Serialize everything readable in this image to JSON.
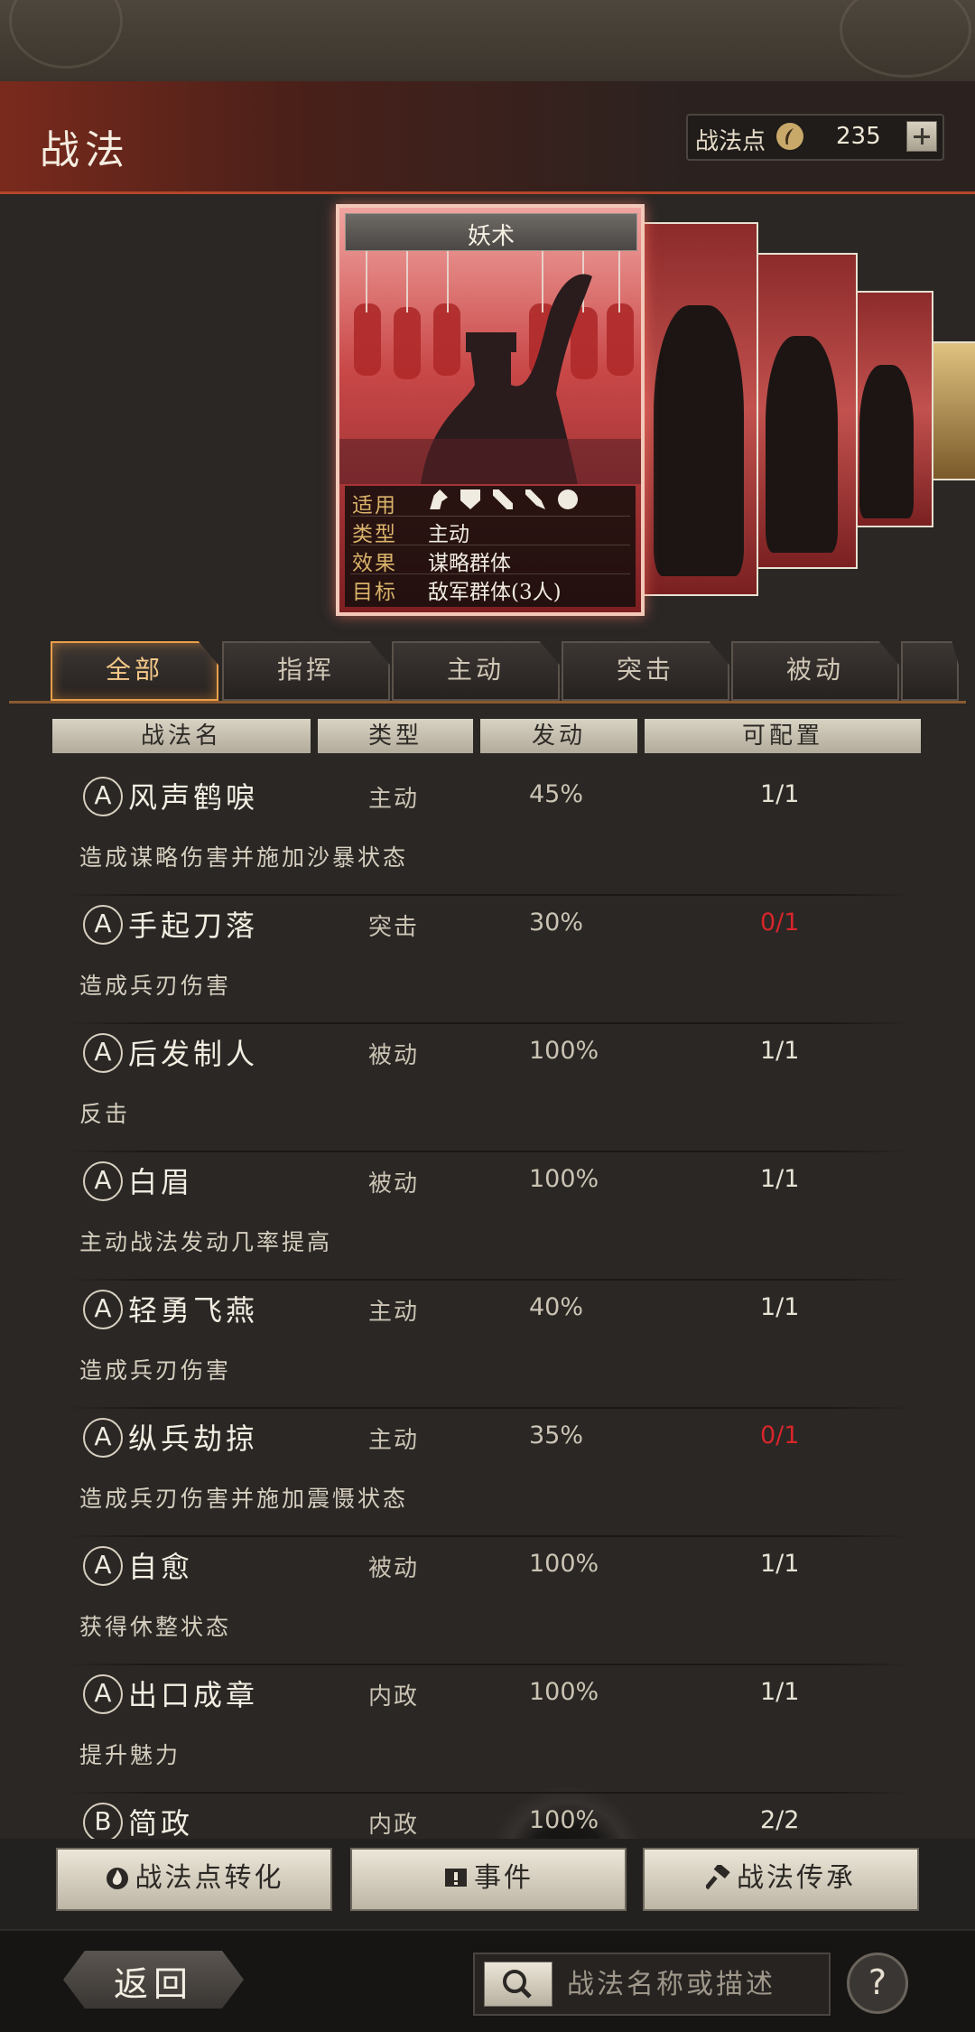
{
  "header": {
    "title": "战法",
    "points_label": "战法点",
    "points_value": "235"
  },
  "card": {
    "name": "妖术",
    "rows": [
      {
        "key": "适用",
        "value": ""
      },
      {
        "key": "类型",
        "value": "主动"
      },
      {
        "key": "效果",
        "value": "谋略群体"
      },
      {
        "key": "目标",
        "value": "敌军群体(3人)"
      }
    ],
    "applicable_icons": [
      "cavalry-icon",
      "shield-icon",
      "bow-icon",
      "spear-icon",
      "wheel-icon"
    ]
  },
  "tabs": [
    {
      "label": "全部",
      "active": true
    },
    {
      "label": "指挥",
      "active": false
    },
    {
      "label": "主动",
      "active": false
    },
    {
      "label": "突击",
      "active": false
    },
    {
      "label": "被动",
      "active": false
    }
  ],
  "table_headers": [
    "战法名",
    "类型",
    "发动",
    "可配置"
  ],
  "skills": [
    {
      "grade": "A",
      "name": "风声鹤唳",
      "type": "主动",
      "rate": "45%",
      "config": "1/1",
      "config_full": false,
      "desc": "造成谋略伤害并施加沙暴状态"
    },
    {
      "grade": "A",
      "name": "手起刀落",
      "type": "突击",
      "rate": "30%",
      "config": "0/1",
      "config_full": true,
      "desc": "造成兵刃伤害"
    },
    {
      "grade": "A",
      "name": "后发制人",
      "type": "被动",
      "rate": "100%",
      "config": "1/1",
      "config_full": false,
      "desc": "反击"
    },
    {
      "grade": "A",
      "name": "白眉",
      "type": "被动",
      "rate": "100%",
      "config": "1/1",
      "config_full": false,
      "desc": "主动战法发动几率提高"
    },
    {
      "grade": "A",
      "name": "轻勇飞燕",
      "type": "主动",
      "rate": "40%",
      "config": "1/1",
      "config_full": false,
      "desc": "造成兵刃伤害"
    },
    {
      "grade": "A",
      "name": "纵兵劫掠",
      "type": "主动",
      "rate": "35%",
      "config": "0/1",
      "config_full": true,
      "desc": "造成兵刃伤害并施加震慑状态"
    },
    {
      "grade": "A",
      "name": "自愈",
      "type": "被动",
      "rate": "100%",
      "config": "1/1",
      "config_full": false,
      "desc": "获得休整状态"
    },
    {
      "grade": "A",
      "name": "出口成章",
      "type": "内政",
      "rate": "100%",
      "config": "1/1",
      "config_full": false,
      "desc": "提升魅力"
    },
    {
      "grade": "B",
      "name": "简政",
      "type": "内政",
      "rate": "100%",
      "config": "2/2",
      "config_full": false,
      "desc": ""
    }
  ],
  "actions": {
    "convert": "战法点转化",
    "event": "事件",
    "inherit": "战法传承"
  },
  "footer": {
    "back": "返回",
    "search_placeholder": "战法名称或描述",
    "help": "?"
  },
  "colors": {
    "accent_red": "#d6262a",
    "tab_active": "#e8a04a",
    "header_red": "#7a2a1c"
  }
}
